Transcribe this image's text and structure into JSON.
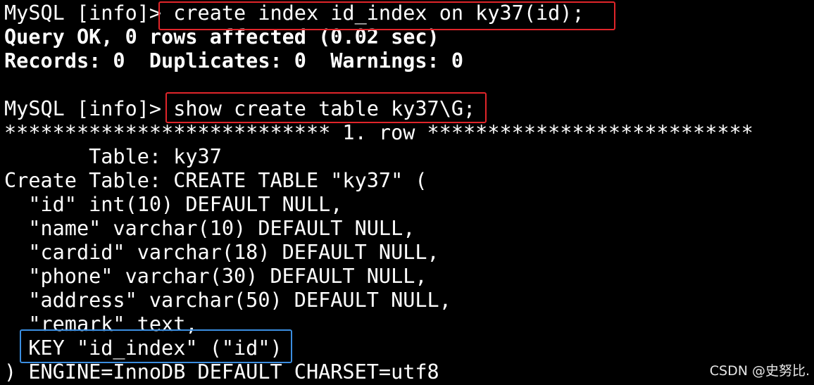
{
  "terminal": {
    "background": "#000000",
    "foreground": "#ffffff",
    "highlight_colors": {
      "command": "#e0252a",
      "key_line": "#3b8ee0"
    },
    "lines": [
      {
        "prompt": "MySQL [info]> ",
        "text": "create index id_index on ky37(id);"
      },
      {
        "text": "Query OK, 0 rows affected (0.02 sec)"
      },
      {
        "text": "Records: 0  Duplicates: 0  Warnings: 0"
      },
      {
        "text": ""
      },
      {
        "prompt": "MySQL [info]> ",
        "text": "show create table ky37\\G;"
      },
      {
        "text": "*************************** 1. row ***************************"
      },
      {
        "text": "       Table: ky37"
      },
      {
        "text": "Create Table: CREATE TABLE \"ky37\" ("
      },
      {
        "text": "  \"id\" int(10) DEFAULT NULL,"
      },
      {
        "text": "  \"name\" varchar(10) DEFAULT NULL,"
      },
      {
        "text": "  \"cardid\" varchar(18) DEFAULT NULL,"
      },
      {
        "text": "  \"phone\" varchar(30) DEFAULT NULL,"
      },
      {
        "text": "  \"address\" varchar(50) DEFAULT NULL,"
      },
      {
        "text": "  \"remark\" text,"
      },
      {
        "text": "  KEY \"id_index\" (\"id\")"
      },
      {
        "text": ") ENGINE=InnoDB DEFAULT CHARSET=utf8"
      }
    ]
  },
  "watermark": "CSDN @史努比."
}
